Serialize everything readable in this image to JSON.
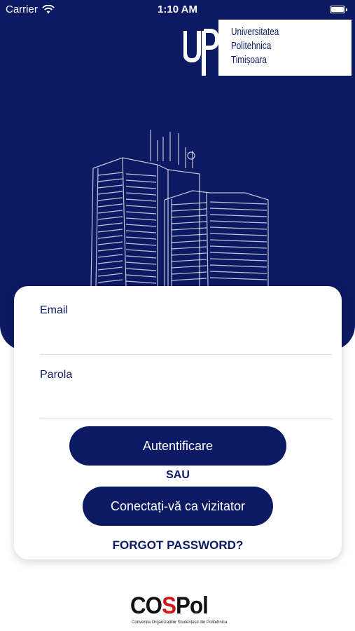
{
  "status_bar": {
    "carrier": "Carrier",
    "time": "1:10 AM"
  },
  "logo": {
    "mark": "UPT",
    "line1": "Universitatea",
    "line2": "Politehnica",
    "line3": "Timișoara"
  },
  "form": {
    "email_label": "Email",
    "email_value": "",
    "password_label": "Parola",
    "password_value": "",
    "login_button": "Autentificare",
    "or_text": "SAU",
    "guest_button": "Conectați-vă ca vizitator",
    "forgot_password": "FORGOT PASSWORD?"
  },
  "footer": {
    "logo_main_a": "CO",
    "logo_main_b": "S",
    "logo_main_c": "Pol",
    "logo_subtitle": "Convenția Organizațiilor Studențești din Politehnica"
  },
  "colors": {
    "primary": "#0c1a63",
    "accent": "#d01818",
    "background": "#ffffff"
  }
}
